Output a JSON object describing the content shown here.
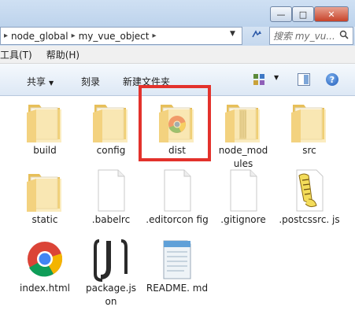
{
  "window": {
    "minimize_glyph": "—",
    "maximize_glyph": "□",
    "close_glyph": "✕"
  },
  "address": {
    "segments": [
      "node_global",
      "my_vue_object"
    ],
    "refresh_glyph": "↻"
  },
  "search": {
    "placeholder": "搜索 my_vu..."
  },
  "menu": {
    "items": [
      "工具(T)",
      "帮助(H)"
    ]
  },
  "toolbar": {
    "share_label": "共享",
    "burn_label": "刻录",
    "new_folder_label": "新建文件夹",
    "help_glyph": "?"
  },
  "files": [
    {
      "name": "build",
      "type": "folder"
    },
    {
      "name": "config",
      "type": "folder"
    },
    {
      "name": "dist",
      "type": "folder-chrome"
    },
    {
      "name": "node_mod ules",
      "type": "folder-striped"
    },
    {
      "name": "src",
      "type": "folder"
    },
    {
      "name": "static",
      "type": "folder"
    },
    {
      "name": ".babelrc",
      "type": "blank"
    },
    {
      "name": ".editorcon fig",
      "type": "blank"
    },
    {
      "name": ".gitignore",
      "type": "blank"
    },
    {
      "name": ".postcssrc. js",
      "type": "script"
    },
    {
      "name": "index.html",
      "type": "chrome"
    },
    {
      "name": "package.js on",
      "type": "json"
    },
    {
      "name": "README. md",
      "type": "notepad"
    }
  ],
  "colors": {
    "selection_outline": "#e3322c",
    "folder_yellow": "#f2d27a"
  }
}
